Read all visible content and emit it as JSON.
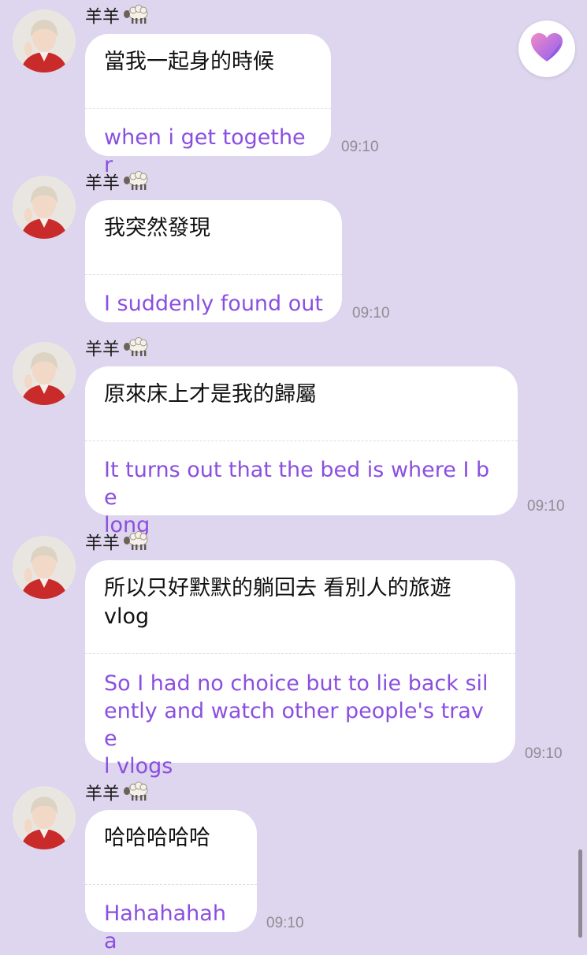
{
  "chat": {
    "messages": [
      {
        "sender": "羊羊",
        "original": "當我一起身的時候",
        "translation": "when i get together",
        "time": "09:10"
      },
      {
        "sender": "羊羊",
        "original": "我突然發現",
        "translation": "I suddenly found out",
        "time": "09:10"
      },
      {
        "sender": "羊羊",
        "original": "原來床上才是我的歸屬",
        "translation": "It turns out that the bed is where I be\nlong",
        "time": "09:10"
      },
      {
        "sender": "羊羊",
        "original": "所以只好默默的躺回去 看別人的旅遊\nvlog",
        "translation": "So I had no choice but to lie back sil\nently and watch other people's trave\nl vlogs",
        "time": "09:10"
      },
      {
        "sender": "羊羊",
        "original": "哈哈哈哈哈",
        "translation": "Hahahahaha",
        "time": "09:10"
      }
    ]
  },
  "icons": {
    "sender_emoji": "sheep-icon",
    "floating_button": "heart-icon"
  },
  "colors": {
    "background": "#ded5ee",
    "bubble": "#ffffff",
    "translation_text": "#8b4fdf",
    "timestamp": "#8e8e93",
    "heart_gradient_start": "#f38ac8",
    "heart_gradient_end": "#8a5ef0"
  }
}
